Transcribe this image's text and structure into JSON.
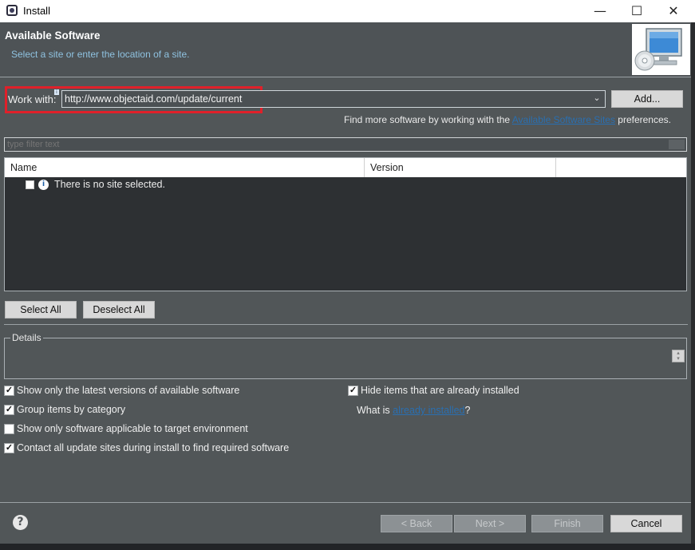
{
  "window": {
    "title": "Install",
    "minimize_glyph": "—",
    "maximize_glyph": "☐",
    "close_glyph": "✕"
  },
  "header": {
    "title": "Available Software",
    "description": "Select a site or enter the location of a site."
  },
  "work_with": {
    "label": "Work with:",
    "value": "http://www.objectaid.com/update/current",
    "add_label": "Add...",
    "find_more_prefix": "Find more software by working with the ",
    "find_more_link": "Available Software Sites",
    "find_more_suffix": " preferences."
  },
  "filter": {
    "placeholder": "type filter text"
  },
  "table": {
    "columns": [
      "Name",
      "Version",
      ""
    ],
    "rows": [
      {
        "name": "There is no site selected.",
        "version": ""
      }
    ]
  },
  "selection_buttons": {
    "select_all": "Select All",
    "deselect_all": "Deselect All"
  },
  "details": {
    "label": "Details"
  },
  "options": {
    "left": [
      {
        "label": "Show only the latest versions of available software",
        "checked": true
      },
      {
        "label": "Group items by category",
        "checked": true
      },
      {
        "label": "Show only software applicable to target environment",
        "checked": false
      },
      {
        "label": "Contact all update sites during install to find required software",
        "checked": true
      }
    ],
    "right": [
      {
        "label": "Hide items that are already installed",
        "checked": true
      }
    ],
    "what_is_prefix": "What is ",
    "what_is_link": "already installed",
    "what_is_suffix": "?"
  },
  "footer": {
    "back": "< Back",
    "next": "Next >",
    "finish": "Finish",
    "cancel": "Cancel"
  }
}
